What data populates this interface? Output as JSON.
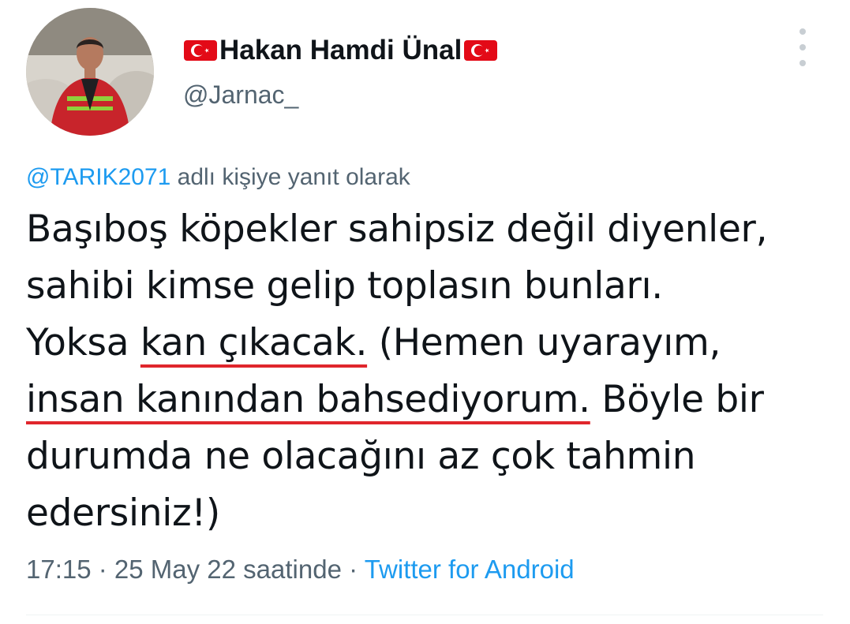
{
  "user": {
    "flag_left": "turkish-flag-emoji",
    "display_name": "Hakan Hamdi Ünal",
    "flag_right": "turkish-flag-emoji",
    "handle": "@Jarnac_"
  },
  "reply": {
    "mention": "@TARIK2071",
    "suffix": " adlı kişiye yanıt olarak"
  },
  "tweet": {
    "line1": "Başıboş köpekler sahipsiz değil diyenler,",
    "line2": "sahibi kimse gelip toplasın bunları.",
    "line3_pre": "Yoksa ",
    "line3_underlined": "kan çıkacak.",
    "line3_post": " (Hemen uyarayım,",
    "line4_underlined": "insan kanından bahsediyorum.",
    "line4_post": " Böyle bir",
    "line5": "durumda ne olacağını az çok tahmin",
    "line6": "edersiniz!)",
    "underline_color": "#e0262c"
  },
  "meta": {
    "time": "17:15",
    "sep1": " · ",
    "date": "25 May 22 saatinde",
    "sep2": " · ",
    "source": "Twitter for Android"
  },
  "colors": {
    "text": "#0f1419",
    "secondary": "#536471",
    "link": "#1d9bf0",
    "flag_red": "#e30a17"
  },
  "icons": {
    "more": "more-vertical-icon"
  }
}
